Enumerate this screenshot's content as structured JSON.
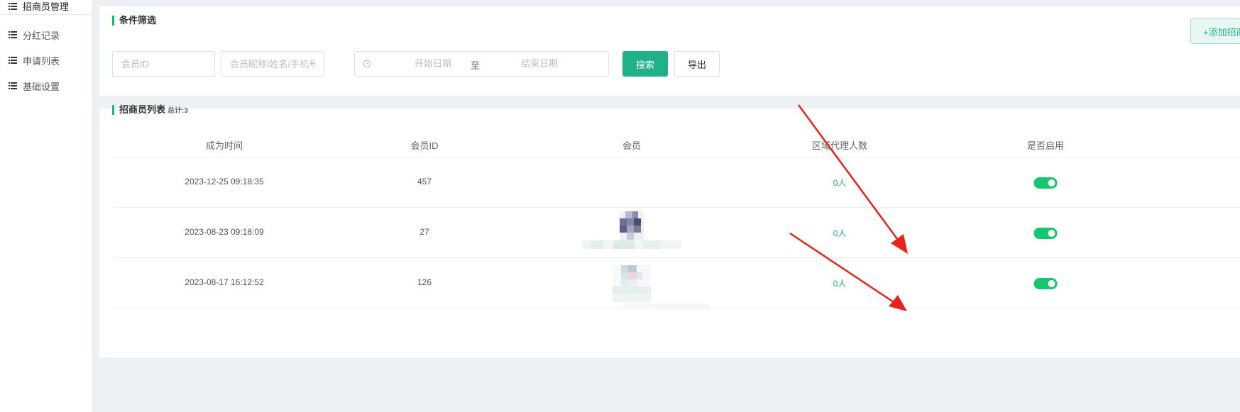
{
  "sidebar": {
    "items": [
      {
        "label": "招商员管理",
        "icon": "list-icon"
      },
      {
        "label": "分红记录",
        "icon": "list-icon"
      },
      {
        "label": "申请列表",
        "icon": "list-icon"
      },
      {
        "label": "基础设置",
        "icon": "list-icon"
      }
    ]
  },
  "filter": {
    "title": "条件筛选",
    "add_button_label": "+添加招商",
    "member_id_placeholder": "会员ID",
    "member_info_placeholder": "会员昵称/姓名/手机号",
    "date_start_placeholder": "开始日期",
    "date_separator": "至",
    "date_end_placeholder": "结束日期",
    "search_label": "搜索",
    "export_label": "导出"
  },
  "list": {
    "title": "招商员列表",
    "count_text": "总计:3",
    "columns": [
      "成为时间",
      "会员ID",
      "会员",
      "区域代理人数",
      "是否启用"
    ],
    "rows": [
      {
        "time": "2023-12-25 09:18:35",
        "member_id": "457",
        "agents": "0人",
        "enabled": true
      },
      {
        "time": "2023-08-23 09:18:09",
        "member_id": "27",
        "agents": "0人",
        "enabled": true
      },
      {
        "time": "2023-08-17 16:12:52",
        "member_id": "126",
        "agents": "0人",
        "enabled": true
      }
    ]
  },
  "colors": {
    "accent": "#1fb18a",
    "switch_on": "#13c76e",
    "arrow": "#e8231d"
  }
}
